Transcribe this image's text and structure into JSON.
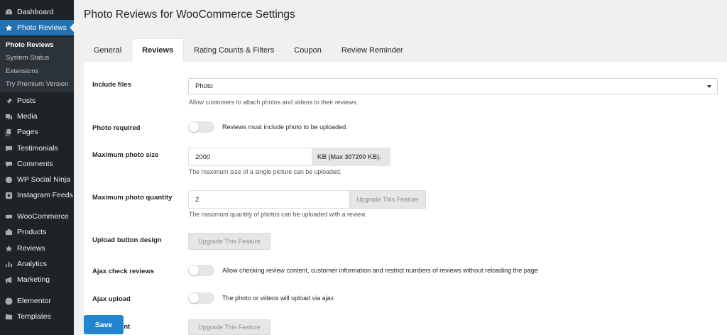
{
  "sidebar": {
    "items": [
      {
        "label": "Dashboard",
        "icon": "dashboard-icon"
      },
      {
        "label": "Photo Reviews",
        "icon": "star-icon"
      },
      {
        "label": "Posts",
        "icon": "pin-icon"
      },
      {
        "label": "Media",
        "icon": "media-icon"
      },
      {
        "label": "Pages",
        "icon": "pages-icon"
      },
      {
        "label": "Testimonials",
        "icon": "testimonials-icon"
      },
      {
        "label": "Comments",
        "icon": "comments-icon"
      },
      {
        "label": "WP Social Ninja",
        "icon": "ninja-icon"
      },
      {
        "label": "Instagram Feeds",
        "icon": "instagram-icon"
      },
      {
        "label": "WooCommerce",
        "icon": "woocommerce-icon"
      },
      {
        "label": "Products",
        "icon": "products-icon"
      },
      {
        "label": "Reviews",
        "icon": "star-icon"
      },
      {
        "label": "Analytics",
        "icon": "analytics-icon"
      },
      {
        "label": "Marketing",
        "icon": "megaphone-icon"
      },
      {
        "label": "Elementor",
        "icon": "elementor-icon"
      },
      {
        "label": "Templates",
        "icon": "folder-icon"
      }
    ],
    "submenu": [
      "Photo Reviews",
      "System Status",
      "Extensions",
      "Try Premium Version"
    ]
  },
  "page": {
    "title": "Photo Reviews for WooCommerce Settings",
    "tabs": [
      "General",
      "Reviews",
      "Rating Counts & Filters",
      "Coupon",
      "Review Reminder"
    ]
  },
  "settings": {
    "include_files": {
      "label": "Include files",
      "value": "Photo",
      "desc": "Allow customers to attach photos and videos to their reviews."
    },
    "photo_required": {
      "label": "Photo required",
      "text": "Reviews must include photo to be uploaded."
    },
    "max_photo_size": {
      "label": "Maximum photo size",
      "value": "2000",
      "addon": "KB (Max 307200 KB).",
      "desc": "The maximum size of a single picture can be uploaded."
    },
    "max_photo_quantity": {
      "label": "Maximum photo quantity",
      "value": "2",
      "addon": "Upgrade This Feature",
      "desc": "The maximum quantity of photos can be uploaded with a review."
    },
    "upload_button_design": {
      "label": "Upload button design",
      "addon": "Upgrade This Feature"
    },
    "ajax_check_reviews": {
      "label": "Ajax check reviews",
      "text": "Allow checking review content, customer information and restrict numbers of reviews without reloading the page"
    },
    "ajax_upload": {
      "label": "Ajax upload",
      "text": "The photo or videos will upload via ajax"
    },
    "empty_comment": {
      "label": "ty comment",
      "addon": "Upgrade This Feature"
    }
  },
  "save_label": "Save",
  "colors": {
    "sidebar": "#1d2327",
    "active": "#2271b1",
    "save": "#2185d0"
  }
}
